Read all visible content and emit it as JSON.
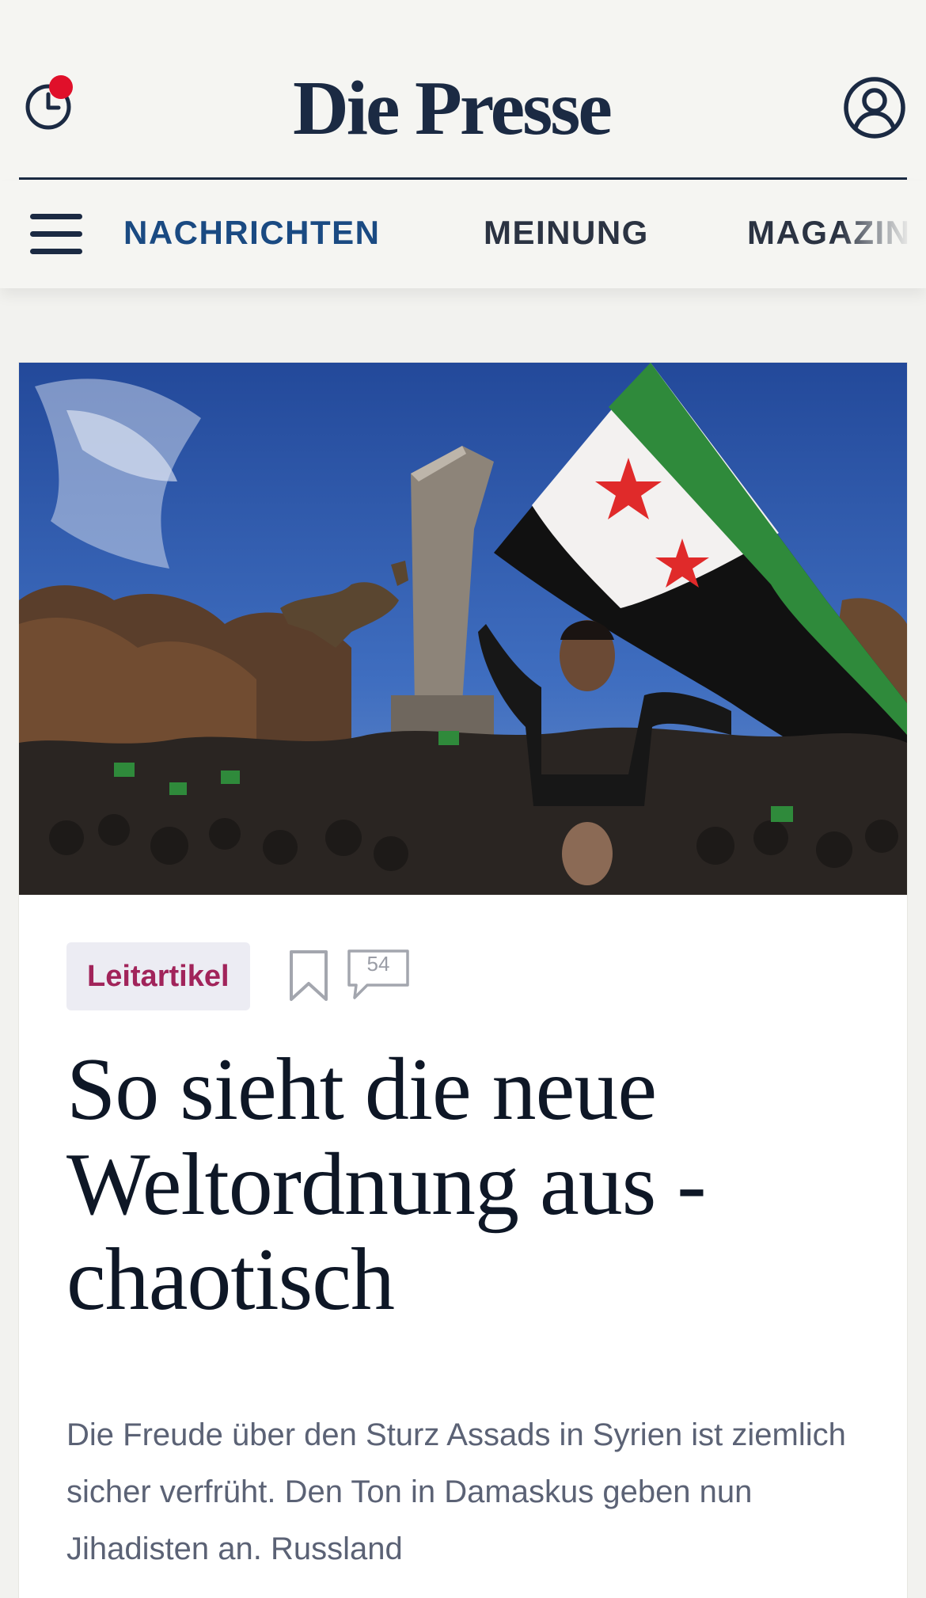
{
  "masthead": {
    "logo_text": "Die Presse",
    "history_icon": "clock-icon",
    "notification_dot_color": "#e0102a",
    "account_icon": "user-icon"
  },
  "nav": {
    "menu_icon": "hamburger-menu-icon",
    "items": [
      {
        "label": "NACHRICHTEN",
        "active": true
      },
      {
        "label": "MEINUNG",
        "active": false
      },
      {
        "label": "MAGAZIN",
        "active": false
      }
    ]
  },
  "article": {
    "hero_image_alt": "Crowd waving green-white-black flags with red stars at a monument with an equestrian statue under a blue sky",
    "tag": "Leitartikel",
    "bookmark_icon": "bookmark-icon",
    "comments_icon": "comment-bubble-icon",
    "comment_count": "54",
    "headline": "So sieht die neue Weltordnung aus - chaotisch",
    "lead": "Die Freude über den Sturz Assads in Syrien ist ziemlich sicher verfrüht. Den Ton in Damaskus geben nun Jihadisten an. Russland"
  },
  "colors": {
    "brand_navy": "#1b2a43",
    "nav_active": "#1a4a82",
    "tag_text": "#a1245a",
    "tag_background": "#ececf3"
  }
}
